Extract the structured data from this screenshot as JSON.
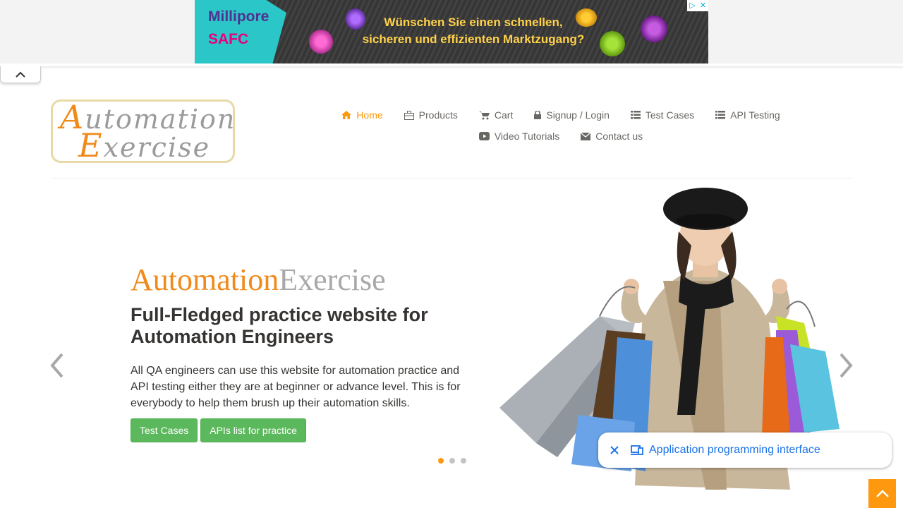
{
  "ad": {
    "brand_line1": "Millipore",
    "brand_line2": "SAFC",
    "headline_line1": "Wünschen Sie einen schnellen,",
    "headline_line2": "sicheren und effizienten Marktzugang?",
    "choices_icon": "ad-choices-icon",
    "close_icon": "close-icon"
  },
  "header": {
    "logo_line1": "utomation",
    "logo_cap1": "A",
    "logo_line2": "xercise",
    "logo_cap2": "E",
    "nav": {
      "home": "Home",
      "products": "Products",
      "cart": "Cart",
      "signup_login": "Signup / Login",
      "test_cases": "Test Cases",
      "api_testing": "API Testing",
      "video_tutorials": "Video Tutorials",
      "contact_us": "Contact us"
    }
  },
  "hero": {
    "brand_a": "Automation",
    "brand_b": "Exercise",
    "title": "Full-Fledged practice website for Automation Engineers",
    "description": "All QA engineers can use this website for automation practice and API testing either they are at beginner or advance level. This is for everybody to help them brush up their automation skills.",
    "btn_test_cases": "Test Cases",
    "btn_apis_list": "APIs list for practice",
    "slide_count": 3,
    "active_slide": 1
  },
  "chip": {
    "label": "Application programming interface"
  },
  "colors": {
    "accent": "#fe980f",
    "nav_text": "#696763",
    "button_green": "#5cb85c",
    "chip_blue": "#1a73e8"
  }
}
